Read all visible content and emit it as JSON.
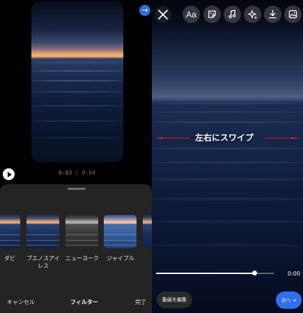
{
  "left": {
    "timecode": {
      "current": "0:03",
      "separator": " / ",
      "total": "0:04"
    },
    "filters": [
      {
        "label": "ダビ"
      },
      {
        "label": "ブエノスアイレス"
      },
      {
        "label": "ニューヨーク"
      },
      {
        "label": "ジャイプル"
      },
      {
        "label": ""
      }
    ],
    "footer": {
      "cancel_label": "キャンセル",
      "title": "フィルター",
      "done_label": "完了"
    },
    "next_arrow_color": "#2f6fd6"
  },
  "right": {
    "toolbar": {
      "close_icon": "close-icon",
      "text_label": "Aa",
      "sticker_icon": "sticker-icon",
      "music_icon": "music-icon",
      "effects_icon": "sparkle-icon",
      "download_icon": "download-icon",
      "image_icon": "image-icon"
    },
    "annotation": {
      "text": "左右にスワイプ",
      "arrow_color": "#e0191f"
    },
    "scrubber": {
      "progress": 0.83,
      "duration": "0:00"
    },
    "edit_video_label": "動画を編集",
    "next_label": "次へ",
    "accent_color": "#2f6fe8"
  }
}
